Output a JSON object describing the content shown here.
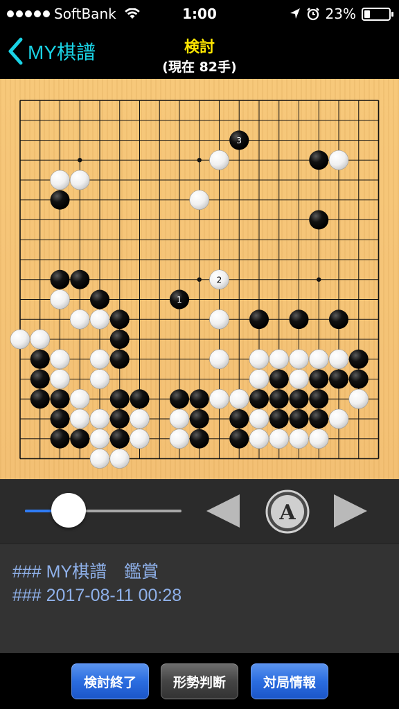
{
  "status_bar": {
    "carrier": "SoftBank",
    "time": "1:00",
    "battery": "23%",
    "battery_level": 0.23
  },
  "nav": {
    "back_label": "MY棋譜",
    "title": "検討",
    "subtitle": "(現在 82手)"
  },
  "board": {
    "size": 19,
    "star_points": [
      [
        3,
        3
      ],
      [
        3,
        9
      ],
      [
        3,
        15
      ],
      [
        9,
        3
      ],
      [
        9,
        9
      ],
      [
        9,
        15
      ],
      [
        15,
        3
      ],
      [
        15,
        9
      ],
      [
        15,
        15
      ]
    ],
    "black_stones": [
      [
        11,
        2
      ],
      [
        11,
        3
      ],
      [
        11,
        5
      ],
      [
        11,
        15
      ],
      [
        11,
        16
      ],
      [
        11,
        17
      ],
      [
        12,
        1
      ],
      [
        12,
        5
      ],
      [
        12,
        12
      ],
      [
        12,
        17
      ],
      [
        12,
        18
      ],
      [
        13,
        0
      ],
      [
        13,
        10
      ],
      [
        13,
        11
      ],
      [
        13,
        17
      ],
      [
        13,
        18
      ],
      [
        14,
        3
      ],
      [
        14,
        8
      ],
      [
        14,
        9
      ],
      [
        14,
        12
      ],
      [
        14,
        13
      ],
      [
        14,
        14
      ],
      [
        14,
        15
      ],
      [
        15,
        0
      ],
      [
        15,
        1
      ],
      [
        15,
        2
      ],
      [
        15,
        3
      ],
      [
        15,
        5
      ],
      [
        15,
        6
      ],
      [
        16,
        1
      ],
      [
        16,
        5
      ],
      [
        16,
        7
      ],
      [
        16,
        8
      ],
      [
        16,
        9
      ],
      [
        17,
        1
      ],
      [
        17,
        2
      ],
      [
        17,
        3
      ],
      [
        17,
        6
      ],
      [
        17,
        8
      ],
      [
        17,
        9
      ],
      [
        17,
        10
      ],
      [
        17,
        11
      ],
      [
        17,
        12
      ],
      [
        18,
        2
      ],
      [
        18,
        3
      ],
      [
        18,
        5
      ],
      [
        18,
        6
      ],
      [
        18,
        9
      ],
      [
        18,
        11
      ],
      [
        18,
        12
      ],
      [
        18,
        15
      ]
    ],
    "white_stones": [
      [
        1,
        3
      ],
      [
        1,
        9
      ],
      [
        2,
        2
      ],
      [
        2,
        9
      ],
      [
        2,
        12
      ],
      [
        3,
        2
      ],
      [
        3,
        14
      ],
      [
        4,
        13
      ],
      [
        4,
        14
      ],
      [
        4,
        16
      ],
      [
        5,
        0
      ],
      [
        5,
        1
      ],
      [
        5,
        3
      ],
      [
        6,
        2
      ],
      [
        6,
        3
      ],
      [
        6,
        4
      ],
      [
        6,
        5
      ],
      [
        6,
        6
      ],
      [
        6,
        7
      ],
      [
        6,
        8
      ],
      [
        6,
        11
      ],
      [
        6,
        12
      ],
      [
        6,
        13
      ],
      [
        6,
        15
      ],
      [
        6,
        16
      ],
      [
        6,
        17
      ],
      [
        6,
        18
      ],
      [
        7,
        2
      ],
      [
        7,
        3
      ],
      [
        7,
        8
      ],
      [
        7,
        11
      ],
      [
        7,
        13
      ],
      [
        8,
        0
      ],
      [
        8,
        1
      ],
      [
        8,
        2
      ],
      [
        8,
        7
      ],
      [
        8,
        16
      ],
      [
        8,
        17
      ],
      [
        8,
        18
      ],
      [
        9,
        5
      ],
      [
        9,
        7
      ],
      [
        9,
        9
      ],
      [
        9,
        10
      ],
      [
        9,
        16
      ],
      [
        9,
        17
      ],
      [
        10,
        0
      ],
      [
        10,
        5
      ],
      [
        10,
        7
      ],
      [
        10,
        8
      ],
      [
        10,
        12
      ],
      [
        10,
        13
      ],
      [
        10,
        14
      ],
      [
        10,
        15
      ],
      [
        11,
        4
      ],
      [
        11,
        7
      ],
      [
        12,
        4
      ],
      [
        12,
        6
      ],
      [
        12,
        7
      ],
      [
        12,
        11
      ],
      [
        13,
        1
      ],
      [
        13,
        4
      ],
      [
        13,
        13
      ],
      [
        14,
        4
      ],
      [
        14,
        5
      ],
      [
        14,
        6
      ],
      [
        15,
        4
      ],
      [
        15,
        7
      ],
      [
        15,
        8
      ],
      [
        16,
        2
      ],
      [
        16,
        4
      ],
      [
        16,
        10
      ],
      [
        16,
        11
      ],
      [
        16,
        12
      ],
      [
        17,
        4
      ],
      [
        17,
        14
      ],
      [
        17,
        15
      ],
      [
        17,
        16
      ],
      [
        18,
        4
      ],
      [
        18,
        10
      ],
      [
        18,
        13
      ]
    ],
    "numbered_stones": [
      {
        "row": 10,
        "col": 8,
        "color": "black",
        "label": "1"
      },
      {
        "row": 9,
        "col": 10,
        "color": "white",
        "label": "2"
      },
      {
        "row": 2,
        "col": 11,
        "color": "black",
        "label": "3"
      }
    ],
    "visible_stones": {
      "black": [
        [
          2,
          11
        ],
        [
          3,
          15
        ],
        [
          5,
          2
        ],
        [
          6,
          15
        ],
        [
          9,
          2
        ],
        [
          9,
          3
        ],
        [
          10,
          4
        ],
        [
          10,
          8
        ],
        [
          11,
          5
        ],
        [
          11,
          12
        ],
        [
          11,
          14
        ],
        [
          11,
          16
        ],
        [
          12,
          5
        ],
        [
          13,
          1
        ],
        [
          13,
          5
        ],
        [
          13,
          17
        ],
        [
          14,
          1
        ],
        [
          14,
          13
        ],
        [
          14,
          15
        ],
        [
          14,
          16
        ],
        [
          14,
          17
        ],
        [
          15,
          1
        ],
        [
          15,
          2
        ],
        [
          15,
          5
        ],
        [
          15,
          6
        ],
        [
          15,
          8
        ],
        [
          15,
          9
        ],
        [
          15,
          12
        ],
        [
          15,
          13
        ],
        [
          15,
          14
        ],
        [
          15,
          15
        ],
        [
          16,
          2
        ],
        [
          16,
          5
        ],
        [
          16,
          9
        ],
        [
          16,
          11
        ],
        [
          16,
          13
        ],
        [
          16,
          14
        ],
        [
          16,
          15
        ],
        [
          17,
          2
        ],
        [
          17,
          3
        ],
        [
          17,
          5
        ],
        [
          17,
          9
        ],
        [
          17,
          11
        ]
      ],
      "white": [
        [
          3,
          10
        ],
        [
          3,
          16
        ],
        [
          4,
          2
        ],
        [
          4,
          3
        ],
        [
          5,
          9
        ],
        [
          10,
          2
        ],
        [
          11,
          3
        ],
        [
          11,
          4
        ],
        [
          11,
          10
        ],
        [
          12,
          0
        ],
        [
          12,
          1
        ],
        [
          13,
          2
        ],
        [
          13,
          4
        ],
        [
          13,
          10
        ],
        [
          13,
          12
        ],
        [
          13,
          13
        ],
        [
          13,
          14
        ],
        [
          13,
          15
        ],
        [
          13,
          16
        ],
        [
          14,
          2
        ],
        [
          14,
          4
        ],
        [
          14,
          12
        ],
        [
          14,
          14
        ],
        [
          15,
          3
        ],
        [
          15,
          10
        ],
        [
          15,
          11
        ],
        [
          15,
          17
        ],
        [
          16,
          3
        ],
        [
          16,
          4
        ],
        [
          16,
          6
        ],
        [
          16,
          8
        ],
        [
          16,
          12
        ],
        [
          16,
          16
        ],
        [
          17,
          4
        ],
        [
          17,
          6
        ],
        [
          17,
          8
        ],
        [
          17,
          12
        ],
        [
          17,
          13
        ],
        [
          17,
          14
        ],
        [
          17,
          15
        ],
        [
          18,
          4
        ],
        [
          18,
          5
        ]
      ]
    }
  },
  "controls": {
    "slider_value": 0.28,
    "auto_label": "A"
  },
  "comment": {
    "line1": "### MY棋譜　鑑賞",
    "line2": "### 2017-08-11 00:28"
  },
  "toolbar": {
    "end_review": "検討終了",
    "evaluate": "形勢判断",
    "game_info": "対局情報"
  },
  "colors": {
    "accent_cyan": "#1ad3e5",
    "title_yellow": "#ffe600",
    "comment_blue": "#8fb1ea",
    "slider_blue": "#2f7cf6"
  }
}
